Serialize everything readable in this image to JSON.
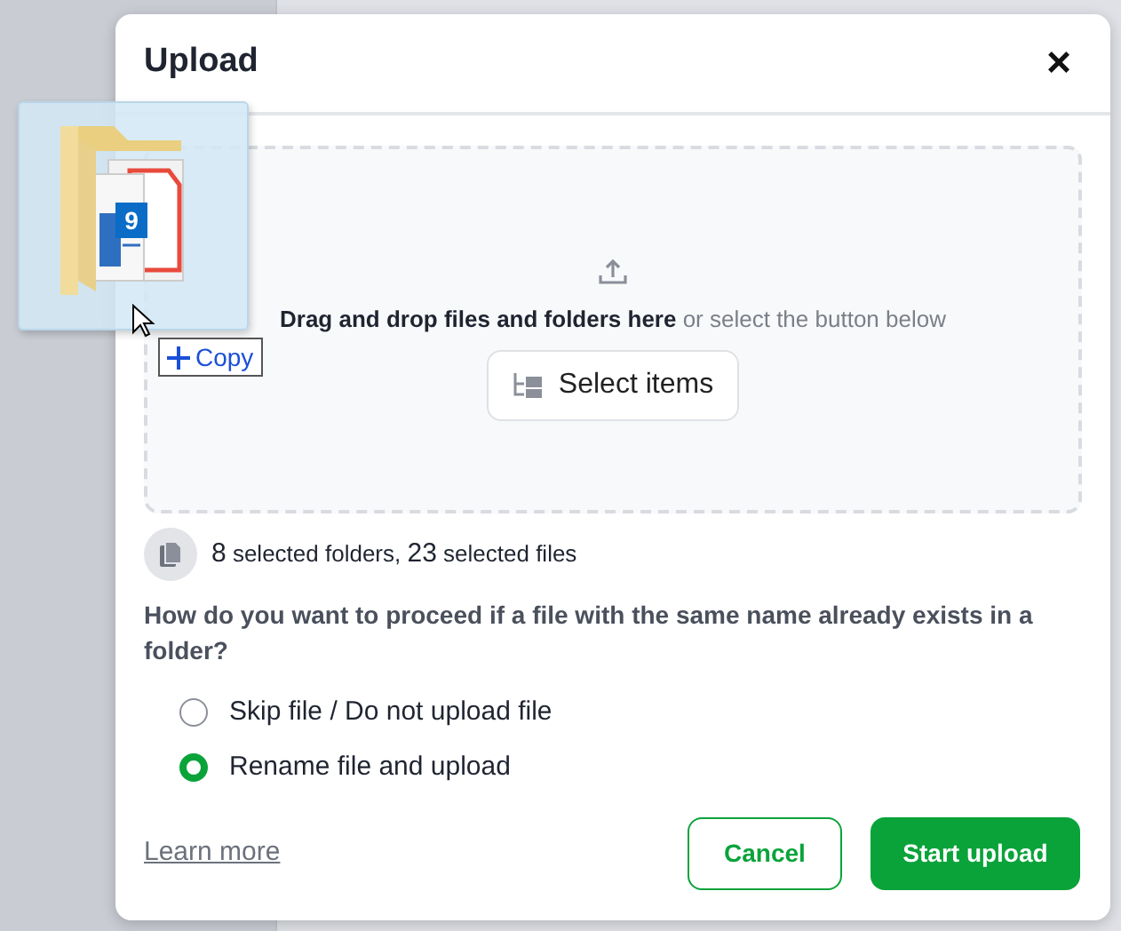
{
  "dialog": {
    "title": "Upload",
    "close": "×",
    "dropzone": {
      "strong": "Drag and drop files and folders here",
      "hint": "or select the button below",
      "button": "Select items"
    },
    "summary": {
      "folders_count": "8",
      "folders_label": "selected folders,",
      "files_count": "23",
      "files_label": "selected files"
    },
    "question": "How do you want to proceed if a file with the same name already exists in a folder?",
    "options": [
      {
        "label": "Skip file / Do not upload file",
        "selected": false
      },
      {
        "label": "Rename file and upload",
        "selected": true
      }
    ],
    "learn_more": "Learn more",
    "buttons": {
      "cancel": "Cancel",
      "start": "Start upload"
    }
  },
  "drag": {
    "count": "9",
    "effect": "Copy"
  }
}
